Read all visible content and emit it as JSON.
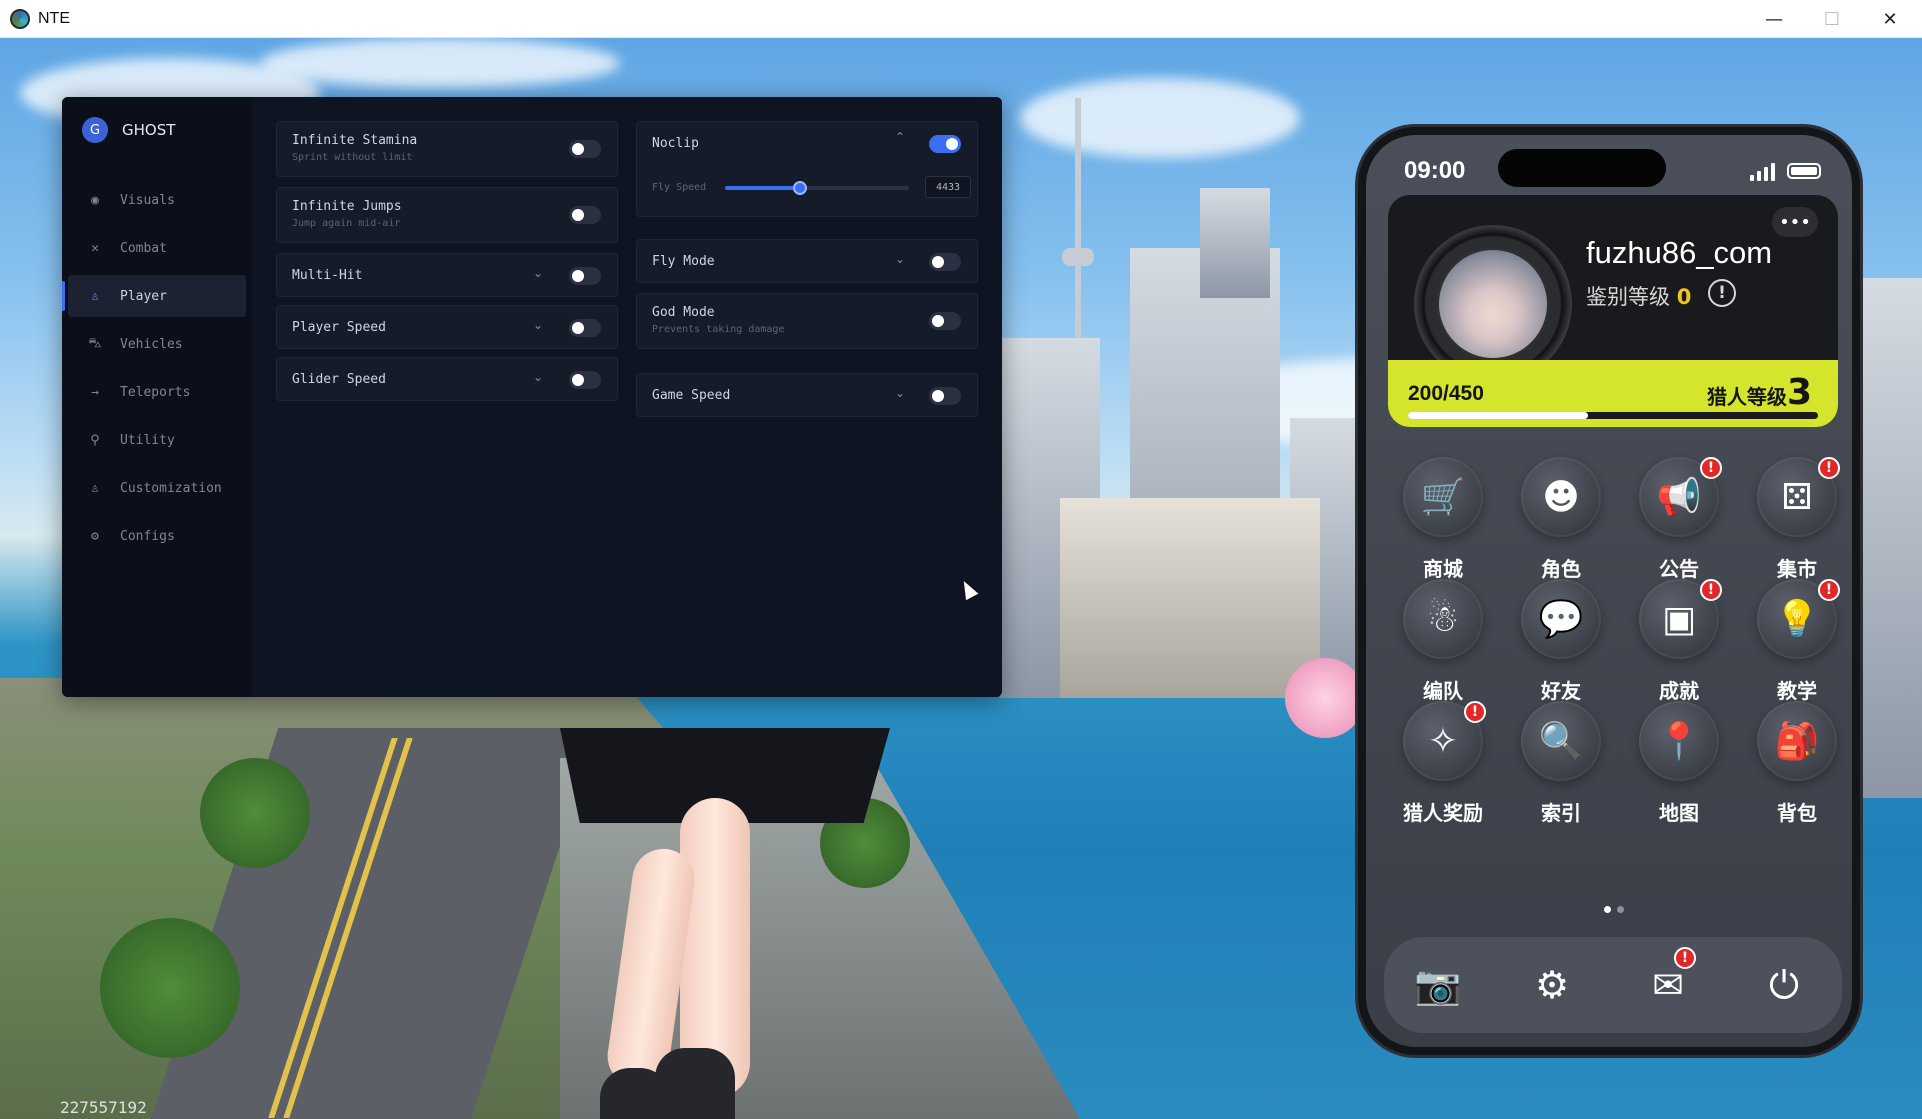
{
  "window": {
    "title": "NTE",
    "minimize": "—",
    "maximize": "☐",
    "close": "✕"
  },
  "panel": {
    "brand_letter": "G",
    "brand_name": "GHOST",
    "nav": [
      {
        "label": "Visuals",
        "icon": "eye-icon",
        "glyph": "◉",
        "active": false
      },
      {
        "label": "Combat",
        "icon": "crossed-swords-icon",
        "glyph": "✕",
        "active": false
      },
      {
        "label": "Player",
        "icon": "person-icon",
        "glyph": "♙",
        "active": true
      },
      {
        "label": "Vehicles",
        "icon": "car-icon",
        "glyph": "⛍",
        "active": false
      },
      {
        "label": "Teleports",
        "icon": "arrow-right-icon",
        "glyph": "→",
        "active": false
      },
      {
        "label": "Utility",
        "icon": "wrench-icon",
        "glyph": "⚲",
        "active": false
      },
      {
        "label": "Customization",
        "icon": "person-outline-icon",
        "glyph": "♙",
        "active": false
      },
      {
        "label": "Configs",
        "icon": "gear-icon",
        "glyph": "⚙",
        "active": false
      }
    ],
    "options": {
      "infinite_stamina": {
        "title": "Infinite Stamina",
        "subtitle": "Sprint without limit",
        "enabled": false
      },
      "infinite_jumps": {
        "title": "Infinite Jumps",
        "subtitle": "Jump again mid-air",
        "enabled": false
      },
      "multi_hit": {
        "title": "Multi-Hit",
        "enabled": false,
        "expanded": false
      },
      "player_speed": {
        "title": "Player Speed",
        "enabled": false,
        "expanded": false
      },
      "glider_speed": {
        "title": "Glider Speed",
        "enabled": false,
        "expanded": false
      },
      "noclip": {
        "title": "Noclip",
        "enabled": true,
        "expanded": true
      },
      "fly_speed": {
        "label": "Fly Speed",
        "value": "4433",
        "fraction": 0.41
      },
      "fly_mode": {
        "title": "Fly Mode",
        "enabled": false,
        "expanded": false
      },
      "god_mode": {
        "title": "God Mode",
        "subtitle": "Prevents taking damage",
        "enabled": false
      },
      "game_speed": {
        "title": "Game Speed",
        "enabled": false,
        "expanded": false
      }
    }
  },
  "phone": {
    "time": "09:00",
    "more": "•••",
    "username": "fuzhu86_com",
    "rank_label": "鉴别等级",
    "rank_value": "0",
    "info": "!",
    "xp": "200/450",
    "xp_fraction": 0.44,
    "level_label": "猎人等级",
    "level_value": "3",
    "apps": [
      {
        "label": "商城",
        "icon": "shopping-cart-icon",
        "glyph": "🛒",
        "badge": false
      },
      {
        "label": "角色",
        "icon": "character-icon",
        "glyph": "☻",
        "badge": false
      },
      {
        "label": "公告",
        "icon": "megaphone-icon",
        "glyph": "📢",
        "badge": true
      },
      {
        "label": "集市",
        "icon": "dice-icon",
        "glyph": "⚄",
        "badge": true
      },
      {
        "label": "编队",
        "icon": "team-icon",
        "glyph": "☃",
        "badge": false
      },
      {
        "label": "好友",
        "icon": "chat-bubble-icon",
        "glyph": "💬",
        "badge": false
      },
      {
        "label": "成就",
        "icon": "robot-icon",
        "glyph": "▣",
        "badge": true
      },
      {
        "label": "教学",
        "icon": "lightbulb-icon",
        "glyph": "💡",
        "badge": true
      },
      {
        "label": "猎人奖励",
        "icon": "compass-icon",
        "glyph": "✧",
        "badge": true
      },
      {
        "label": "索引",
        "icon": "magnifier-document-icon",
        "glyph": "🔍",
        "badge": false
      },
      {
        "label": "地图",
        "icon": "map-pin-icon",
        "glyph": "📍",
        "badge": false
      },
      {
        "label": "背包",
        "icon": "backpack-icon",
        "glyph": "🎒",
        "badge": false
      }
    ],
    "badge_text": "!",
    "dock": [
      {
        "icon": "camera-icon",
        "glyph": "📷",
        "badge": false
      },
      {
        "icon": "settings-gear-icon",
        "glyph": "⚙",
        "badge": false
      },
      {
        "icon": "mail-icon",
        "glyph": "✉",
        "badge": true
      },
      {
        "icon": "power-icon",
        "glyph": "⏻",
        "badge": false
      }
    ]
  },
  "game": {
    "uid_partial": "227557192"
  }
}
